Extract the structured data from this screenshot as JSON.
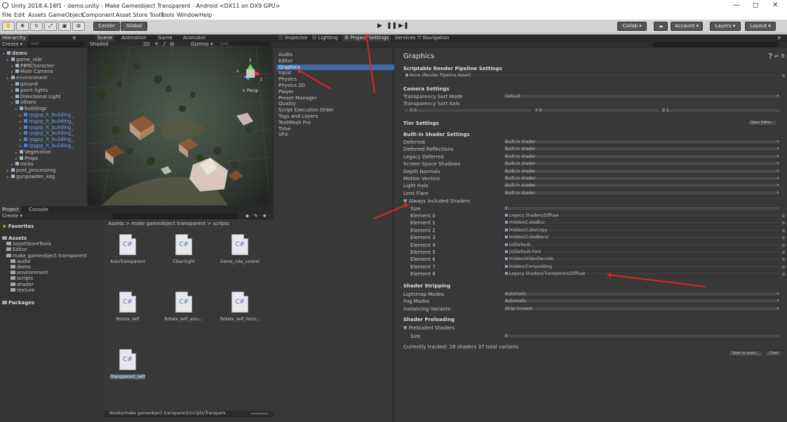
{
  "window": {
    "title": "Unity 2018.4.16f1 - demo.unity - Make Gameobject Transparent - Android <DX11 on DX9 GPU>",
    "minimize": "—",
    "maximize": "◻",
    "close": "✕"
  },
  "menu": [
    "File",
    "Edit",
    "Assets",
    "GameObject",
    "Component",
    "Asset Store Tools",
    "Tools",
    "Window",
    "Help"
  ],
  "toolbar": {
    "pivot": "Center",
    "space": "Global",
    "collab": "Collab ▾",
    "account": "Account ▾",
    "layers": "Layers ▾",
    "layout": "Layout ▾"
  },
  "hierarchy": {
    "tab": "Hierarchy",
    "create": "Create ▾",
    "search_placeholder": "Q▾All",
    "rows": [
      {
        "label": "demo",
        "depth": 0,
        "kind": "scene"
      },
      {
        "label": "game_role",
        "depth": 1
      },
      {
        "label": "PBRCharacter",
        "depth": 2
      },
      {
        "label": "Main Camera",
        "depth": 2
      },
      {
        "label": "environment",
        "depth": 1
      },
      {
        "label": "ground",
        "depth": 2
      },
      {
        "label": "point lights",
        "depth": 2
      },
      {
        "label": "Directional Light",
        "depth": 2
      },
      {
        "label": "others",
        "depth": 2
      },
      {
        "label": "buildings",
        "depth": 3
      },
      {
        "label": "rpgpp_lt_building_",
        "depth": 4,
        "kind": "prefab"
      },
      {
        "label": "rpgpp_lt_building_",
        "depth": 4,
        "kind": "prefab"
      },
      {
        "label": "rpgpp_lt_building_",
        "depth": 4,
        "kind": "prefab"
      },
      {
        "label": "rpgpp_lt_building_",
        "depth": 4,
        "kind": "prefab"
      },
      {
        "label": "rpgpp_lt_building_",
        "depth": 4,
        "kind": "prefab"
      },
      {
        "label": "rpgpp_lt_building_",
        "depth": 4,
        "kind": "prefab"
      },
      {
        "label": "Vegetation",
        "depth": 3
      },
      {
        "label": "Props",
        "depth": 3
      },
      {
        "label": "rocks",
        "depth": 2
      },
      {
        "label": "post_processing",
        "depth": 1
      },
      {
        "label": "gunpowder_keg",
        "depth": 1
      }
    ]
  },
  "scene_view": {
    "tabs": [
      "Scene",
      "Animation",
      "Game",
      "Animator"
    ],
    "shading": "Shaded",
    "mode_2d": "2D",
    "gizmos": "Gizmos ▾",
    "search_placeholder": "Q▾All",
    "persp": "< Persp",
    "axis_y": "y",
    "axis_x": "x",
    "axis_z": "z"
  },
  "project": {
    "tabs": [
      "Project",
      "Console"
    ],
    "create": "Create ▾",
    "breadcrumb": "Assets > make gameobject transparent > scripts",
    "favorites": "Favorites",
    "tree": [
      {
        "label": "Assets",
        "depth": 0,
        "bold": true
      },
      {
        "label": "AssetStoreTools",
        "depth": 1
      },
      {
        "label": "Editor",
        "depth": 1
      },
      {
        "label": "make gameobject transparent",
        "depth": 1
      },
      {
        "label": "audio",
        "depth": 2
      },
      {
        "label": "demo",
        "depth": 2
      },
      {
        "label": "environment",
        "depth": 2
      },
      {
        "label": "scripts",
        "depth": 2
      },
      {
        "label": "shader",
        "depth": 2
      },
      {
        "label": "texture",
        "depth": 2
      },
      {
        "label": "Packages",
        "depth": 0,
        "bold": true
      }
    ],
    "assets": [
      {
        "name": "AutoTransparent",
        "icon": "C#"
      },
      {
        "name": "ClearSight",
        "icon": "C#"
      },
      {
        "name": "Game_role_control",
        "icon": "C#"
      },
      {
        "name": "Rotate_self",
        "icon": "C#"
      },
      {
        "name": "Rotate_self_arou...",
        "icon": "C#"
      },
      {
        "name": "Rotate_self_horiz...",
        "icon": "C#"
      },
      {
        "name": "Transparent_self",
        "icon": "C#"
      }
    ],
    "status_path": "Assets/make gameobject transparent/scripts/Transpare"
  },
  "settings_tabs": [
    "Inspector",
    "Lighting",
    "Project Settings",
    "Services",
    "Navigation"
  ],
  "settings_list": [
    "Audio",
    "Editor",
    "Graphics",
    "Input",
    "Physics",
    "Physics 2D",
    "Player",
    "Preset Manager",
    "Quality",
    "Script Execution Order",
    "Tags and Layers",
    "TextMesh Pro",
    "Time",
    "VFX"
  ],
  "graphics": {
    "title": "Graphics",
    "srp_header": "Scriptable Render Pipeline Settings",
    "srp_value": "None (Render Pipeline Asset)",
    "camera_header": "Camera Settings",
    "sort_mode_label": "Transparency Sort Mode",
    "sort_mode_value": "Default",
    "sort_axis_label": "Transparency Sort Axis",
    "axis_x": "X 0",
    "axis_y": "Y 0",
    "axis_z": "Z 1",
    "tier_header": "Tier Settings",
    "open_editor": "Open Editor...",
    "builtin_header": "Built-in Shader Settings",
    "builtin_rows": [
      {
        "label": "Deferred",
        "value": "Built-in shader"
      },
      {
        "label": "Deferred Reflections",
        "value": "Built-in shader"
      },
      {
        "label": "Legacy Deferred",
        "value": "Built-in shader"
      },
      {
        "label": "Screen Space Shadows",
        "value": "Built-in shader"
      },
      {
        "label": "Depth Normals",
        "value": "Built-in shader"
      },
      {
        "label": "Motion Vectors",
        "value": "Built-in shader"
      },
      {
        "label": "Light Halo",
        "value": "Built-in shader"
      },
      {
        "label": "Lens Flare",
        "value": "Built-in shader"
      }
    ],
    "always_included": "Always Included Shaders",
    "size_label": "Size",
    "size_value": "9",
    "elements": [
      {
        "label": "Element 0",
        "value": "Legacy Shaders/Diffuse"
      },
      {
        "label": "Element 1",
        "value": "Hidden/CubeBlur"
      },
      {
        "label": "Element 2",
        "value": "Hidden/CubeCopy"
      },
      {
        "label": "Element 3",
        "value": "Hidden/CubeBlend"
      },
      {
        "label": "Element 4",
        "value": "UI/Default"
      },
      {
        "label": "Element 5",
        "value": "UI/Default Font"
      },
      {
        "label": "Element 6",
        "value": "Hidden/VideoDecode"
      },
      {
        "label": "Element 7",
        "value": "Hidden/Compositing"
      },
      {
        "label": "Element 8",
        "value": "Legacy Shaders/Transparent/Diffuse"
      }
    ],
    "stripping_header": "Shader Stripping",
    "stripping_rows": [
      {
        "label": "Lightmap Modes",
        "value": "Automatic"
      },
      {
        "label": "Fog Modes",
        "value": "Automatic"
      },
      {
        "label": "Instancing Variants",
        "value": "Strip Unused"
      }
    ],
    "preload_header": "Shader Preloading",
    "preloaded_label": "Preloaded Shaders",
    "preload_size_label": "Size",
    "preload_size_value": "0",
    "tracked": "Currently tracked: 18 shaders 37 total variants",
    "save_asset": "Save to asset...",
    "clear": "Clear"
  },
  "colors": {
    "accent_selection": "#3e6aa9",
    "annotation_arrow": "#e02424",
    "panel_bg": "#383838"
  }
}
